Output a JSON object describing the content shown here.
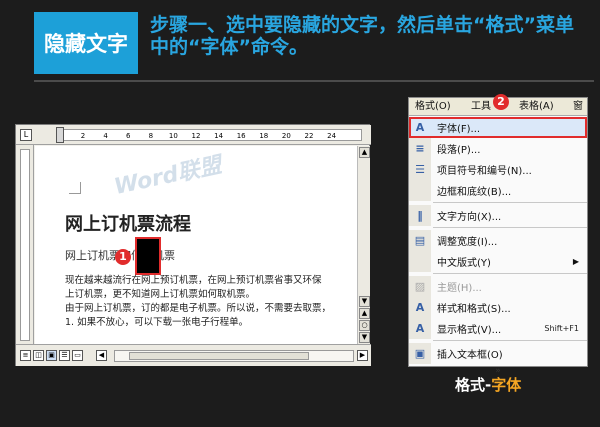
{
  "header": {
    "tag": "隐藏文字",
    "instruction": "步骤一、选中要隐藏的文字，然后单击“格式”菜单中的“字体”命令。"
  },
  "document": {
    "ruler_numbers": [
      "2",
      "4",
      "6",
      "8",
      "10",
      "12",
      "14",
      "16",
      "18",
      "20",
      "22",
      "24"
    ],
    "ruler_corner": "L",
    "watermark": "Word联盟",
    "title": "网上订机票流程",
    "subtitle": "网上订机票如何取机票",
    "body_lines": [
      "现在越来越流行在网上预订机票，在网上预订机票省事又环保",
      "上订机票，更不知道网上订机票如何取机票。",
      "由于网上订机票，订的都是电子机票。所以说，不需要去取票，",
      "1. 如果不放心，可以下载一张电子行程单。"
    ],
    "marker_1": "1"
  },
  "menu": {
    "menubar": [
      "格式(O)",
      "工具",
      "表格(A)",
      "窗"
    ],
    "marker_2": "2",
    "items": [
      {
        "icon": "A",
        "label": "字体(F)...",
        "shortcut": "",
        "arrow": false,
        "disabled": false,
        "highlight": true,
        "sep_after": false
      },
      {
        "icon": "≡",
        "label": "段落(P)...",
        "shortcut": "",
        "arrow": false,
        "disabled": false,
        "highlight": false,
        "sep_after": false
      },
      {
        "icon": "☰",
        "label": "项目符号和编号(N)...",
        "shortcut": "",
        "arrow": false,
        "disabled": false,
        "highlight": false,
        "sep_after": false
      },
      {
        "icon": "",
        "label": "边框和底纹(B)...",
        "shortcut": "",
        "arrow": false,
        "disabled": false,
        "highlight": false,
        "sep_after": true
      },
      {
        "icon": "‖",
        "label": "文字方向(X)...",
        "shortcut": "",
        "arrow": false,
        "disabled": false,
        "highlight": false,
        "sep_after": true
      },
      {
        "icon": "▤",
        "label": "调整宽度(I)...",
        "shortcut": "",
        "arrow": false,
        "disabled": false,
        "highlight": false,
        "sep_after": false
      },
      {
        "icon": "",
        "label": "中文版式(Y)",
        "shortcut": "",
        "arrow": true,
        "disabled": false,
        "highlight": false,
        "sep_after": true
      },
      {
        "icon": "▨",
        "label": "主题(H)...",
        "shortcut": "",
        "arrow": false,
        "disabled": true,
        "highlight": false,
        "sep_after": false
      },
      {
        "icon": "A",
        "label": "样式和格式(S)...",
        "shortcut": "",
        "arrow": false,
        "disabled": false,
        "highlight": false,
        "sep_after": false
      },
      {
        "icon": "A",
        "label": "显示格式(V)...",
        "shortcut": "Shift+F1",
        "arrow": false,
        "disabled": false,
        "highlight": false,
        "sep_after": true
      },
      {
        "icon": "▣",
        "label": "插入文本框(O)",
        "shortcut": "",
        "arrow": false,
        "disabled": false,
        "highlight": false,
        "sep_after": false
      }
    ],
    "expand": "»"
  },
  "caption": {
    "prefix": "格式-",
    "highlight": "字体"
  }
}
